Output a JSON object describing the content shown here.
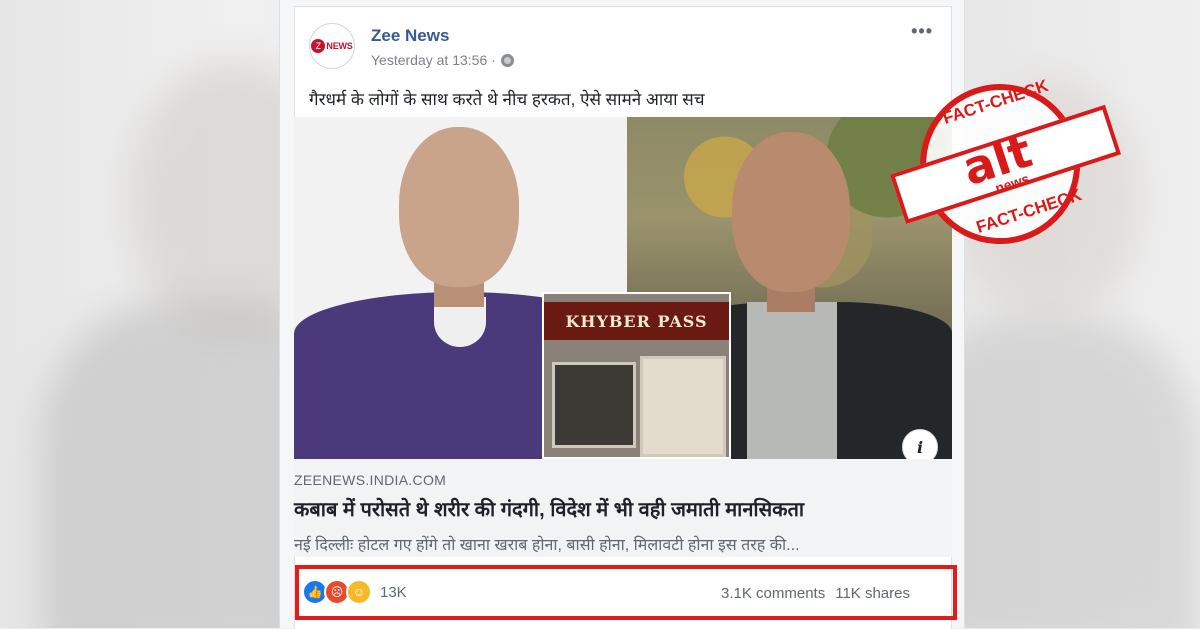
{
  "post": {
    "page_name": "Zee News",
    "timestamp": "Yesterday at 13:56 ·",
    "more_icon": "•••",
    "text": "गैरधर्म के लोगों के साथ करते थे नीच हरकत, ऐसे सामने आया सच",
    "avatar_text": "NEWS",
    "avatar_mark": "Z"
  },
  "link": {
    "shop_sign": "KHYBER PASS",
    "info_label": "i",
    "domain": "ZEENEWS.INDIA.COM",
    "headline": "कबाब में परोसते थे शरीर की गंदगी, विदेश में भी वही जमाती मानसिकता",
    "description": "नई दिल्लीः होटल गए होंगे तो खाना खराब होना, बासी होना, मिलावटी होना इस तरह की..."
  },
  "engagement": {
    "reaction_count": "13K",
    "comments": "3.1K comments",
    "shares": "11K shares",
    "reaction_icons": [
      "like-icon",
      "angry-icon",
      "haha-icon"
    ]
  },
  "stamp": {
    "top": "FACT-CHECK",
    "bottom": "FACT-CHECK",
    "logo": "alt",
    "logo_sub": "news"
  },
  "colors": {
    "name_blue": "#365899",
    "stamp_red": "#d91a1a",
    "highlight_red": "#e31b1b"
  }
}
